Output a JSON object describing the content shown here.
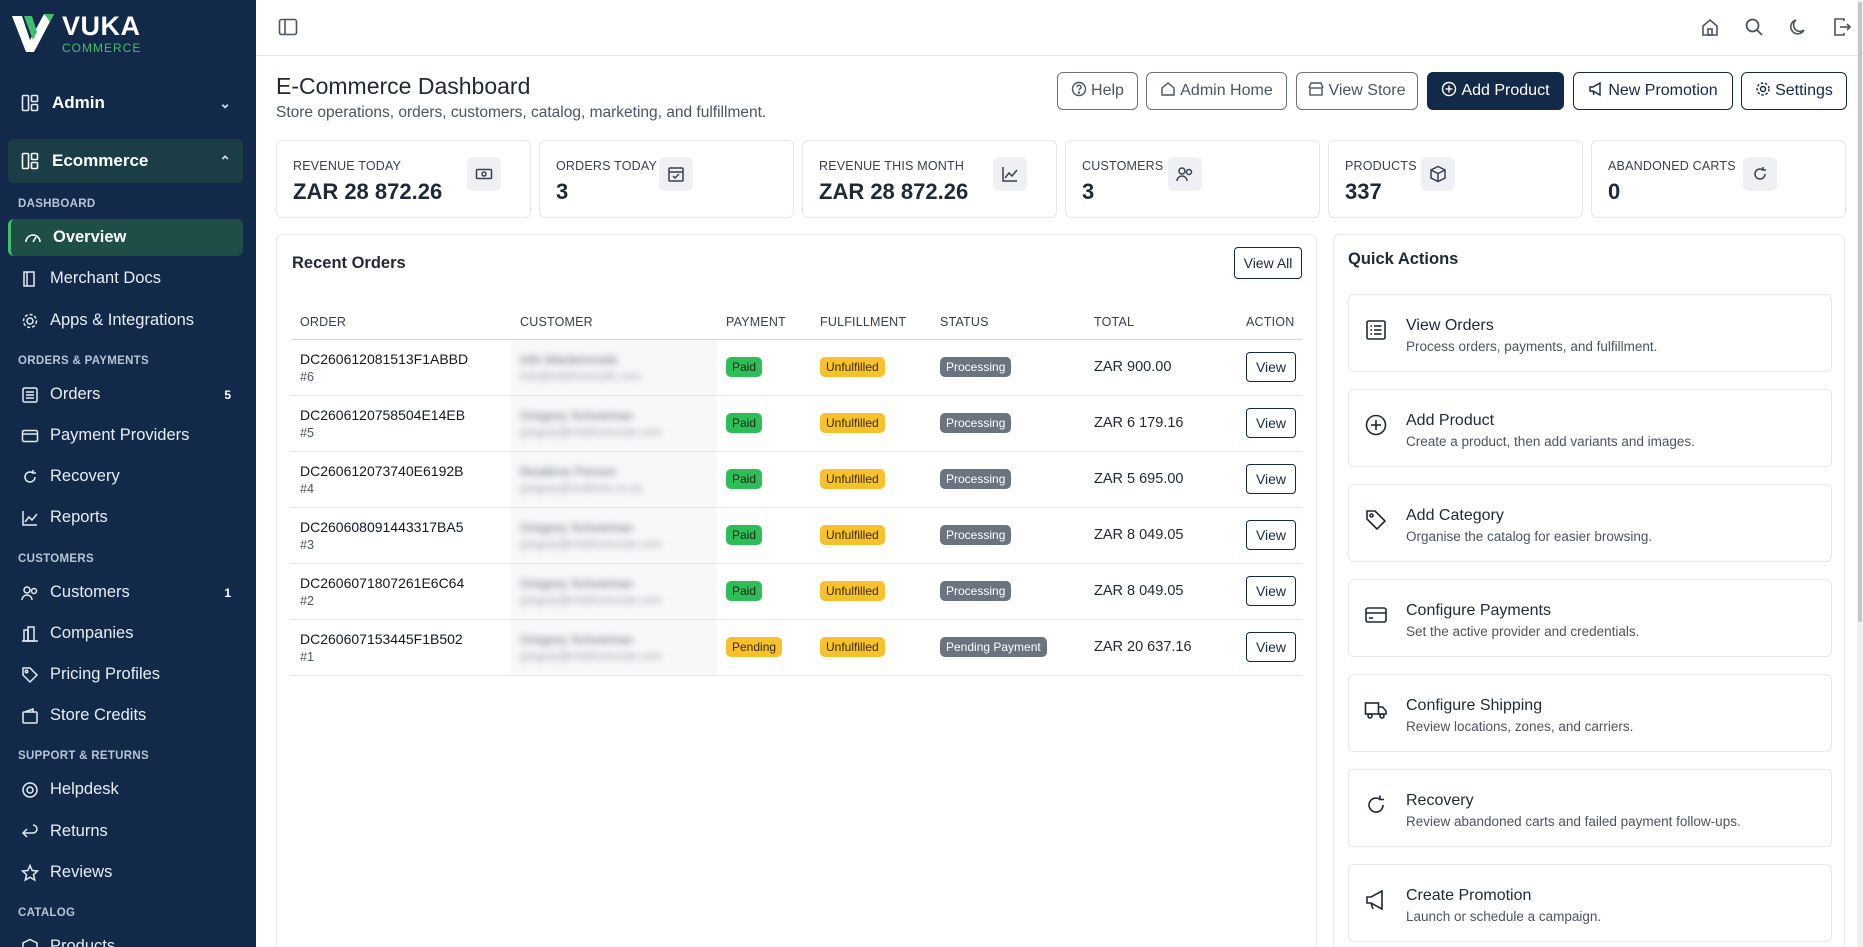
{
  "brand": {
    "name": "VUKA",
    "sub": "COMMERCE"
  },
  "sidebar": {
    "admin_label": "Admin",
    "ecommerce_label": "Ecommerce",
    "groups": {
      "dashboard": "DASHBOARD",
      "orders_payments": "ORDERS & PAYMENTS",
      "customers": "CUSTOMERS",
      "support_returns": "SUPPORT & RETURNS",
      "catalog": "CATALOG"
    },
    "items": {
      "overview": "Overview",
      "merchant_docs": "Merchant Docs",
      "apps": "Apps & Integrations",
      "orders": "Orders",
      "orders_badge": "5",
      "payment_providers": "Payment Providers",
      "recovery": "Recovery",
      "reports": "Reports",
      "customers": "Customers",
      "customers_badge": "1",
      "companies": "Companies",
      "pricing_profiles": "Pricing Profiles",
      "store_credits": "Store Credits",
      "helpdesk": "Helpdesk",
      "returns": "Returns",
      "reviews": "Reviews",
      "products": "Products"
    }
  },
  "header": {
    "title": "E-Commerce Dashboard",
    "subtitle": "Store operations, orders, customers, catalog, marketing, and fulfillment.",
    "buttons": {
      "help": "Help",
      "admin_home": "Admin Home",
      "view_store": "View Store",
      "add_product": "Add Product",
      "new_promotion": "New Promotion",
      "settings": "Settings"
    }
  },
  "stats": [
    {
      "label": "REVENUE TODAY",
      "value": "ZAR 28 872.26",
      "icon": "cash-icon"
    },
    {
      "label": "ORDERS TODAY",
      "value": "3",
      "icon": "calendar-check-icon"
    },
    {
      "label": "REVENUE THIS MONTH",
      "value": "ZAR 28 872.26",
      "icon": "trend-chart-icon"
    },
    {
      "label": "CUSTOMERS",
      "value": "3",
      "icon": "people-icon"
    },
    {
      "label": "PRODUCTS",
      "value": "337",
      "icon": "box-icon"
    },
    {
      "label": "ABANDONED CARTS",
      "value": "0",
      "icon": "refresh-icon"
    }
  ],
  "recent_orders": {
    "title": "Recent Orders",
    "view_all": "View All",
    "columns": [
      "ORDER",
      "CUSTOMER",
      "PAYMENT",
      "FULFILLMENT",
      "STATUS",
      "TOTAL",
      "ACTION"
    ],
    "rows": [
      {
        "order": "DC260612081513F1ABBD",
        "num": "#6",
        "cust_name": "Info Mantenceda",
        "cust_email": "info@mailmorcode.com",
        "payment": "Paid",
        "fulfillment": "Unfulfilled",
        "status": "Processing",
        "total": "ZAR 900.00",
        "action": "View"
      },
      {
        "order": "DC2606120758504E14EB",
        "num": "#5",
        "cust_name": "Gregory Schoeman",
        "cust_email": "gregory@mailmorcode.com",
        "payment": "Paid",
        "fulfillment": "Unfulfilled",
        "status": "Processing",
        "total": "ZAR 6 179.16",
        "action": "View"
      },
      {
        "order": "DC260612073740E6192B",
        "num": "#4",
        "cust_name": "Realtime Person",
        "cust_email": "gregory@realtime.co.za",
        "payment": "Paid",
        "fulfillment": "Unfulfilled",
        "status": "Processing",
        "total": "ZAR 5 695.00",
        "action": "View"
      },
      {
        "order": "DC260608091443317BA5",
        "num": "#3",
        "cust_name": "Gregory Schoeman",
        "cust_email": "gregory@mailmorcode.com",
        "payment": "Paid",
        "fulfillment": "Unfulfilled",
        "status": "Processing",
        "total": "ZAR 8 049.05",
        "action": "View"
      },
      {
        "order": "DC2606071807261E6C64",
        "num": "#2",
        "cust_name": "Gregory Schoeman",
        "cust_email": "gregory@mailmorcode.com",
        "payment": "Paid",
        "fulfillment": "Unfulfilled",
        "status": "Processing",
        "total": "ZAR 8 049.05",
        "action": "View"
      },
      {
        "order": "DC260607153445F1B502",
        "num": "#1",
        "cust_name": "Gregory Schoeman",
        "cust_email": "gregory@mailmorcode.com",
        "payment": "Pending",
        "fulfillment": "Unfulfilled",
        "status": "Pending Payment",
        "total": "ZAR 20 637.16",
        "action": "View"
      }
    ]
  },
  "quick_actions": {
    "title": "Quick Actions",
    "items": [
      {
        "title": "View Orders",
        "desc": "Process orders, payments, and fulfillment.",
        "icon": "list-icon"
      },
      {
        "title": "Add Product",
        "desc": "Create a product, then add variants and images.",
        "icon": "plus-circle-icon"
      },
      {
        "title": "Add Category",
        "desc": "Organise the catalog for easier browsing.",
        "icon": "tag-icon"
      },
      {
        "title": "Configure Payments",
        "desc": "Set the active provider and credentials.",
        "icon": "credit-card-icon"
      },
      {
        "title": "Configure Shipping",
        "desc": "Review locations, zones, and carriers.",
        "icon": "truck-icon"
      },
      {
        "title": "Recovery",
        "desc": "Review abandoned carts and failed payment follow-ups.",
        "icon": "refresh-icon"
      },
      {
        "title": "Create Promotion",
        "desc": "Launch or schedule a campaign.",
        "icon": "megaphone-icon"
      }
    ]
  },
  "colors": {
    "sidebar_bg": "#12294a",
    "accent_green": "#3fbf6b",
    "primary": "#12294a",
    "pill_paid": "#2ebd59",
    "pill_unfulfilled": "#f6c12b",
    "pill_status": "#6b7280"
  }
}
